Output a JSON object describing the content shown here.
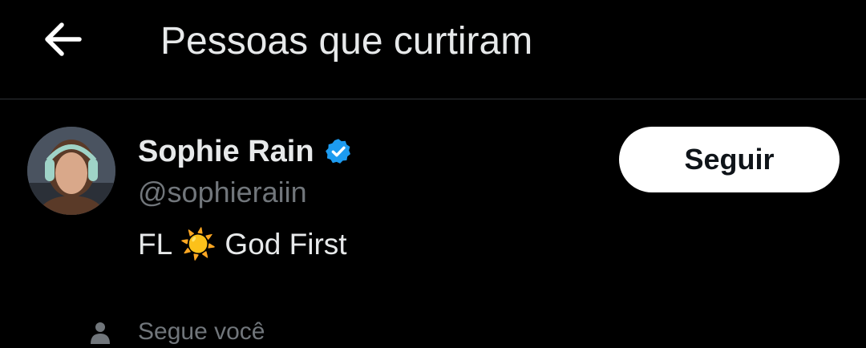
{
  "header": {
    "back_icon": "arrow-left-icon",
    "title": "Pessoas que curtiram"
  },
  "user": {
    "display_name": "Sophie Rain",
    "verified_icon": "verified-badge-icon",
    "verified_color": "#1d9bf0",
    "handle": "@sophieraiin",
    "bio": "FL ☀️ God First",
    "follow_label": "Seguir",
    "follows_you_icon": "person-icon",
    "follows_you_label": "Segue você"
  },
  "colors": {
    "background": "#000000",
    "primary_text": "#e7e9ea",
    "secondary_text": "#71767b",
    "divider": "#2f3336",
    "button_bg": "#ffffff",
    "button_text": "#0f1419"
  }
}
